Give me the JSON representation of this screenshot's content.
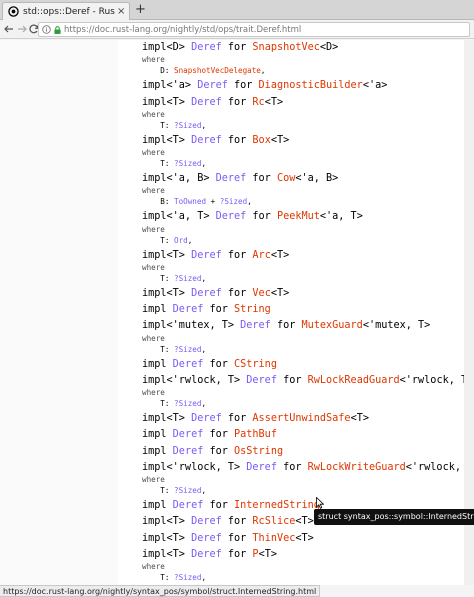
{
  "browser": {
    "tab_title": "std::ops::Deref - Rust",
    "close_glyph": "×",
    "newtab_glyph": "+",
    "url": "https://doc.rust-lang.org/nightly/std/ops/trait.Deref.html"
  },
  "code_lines": [
    {
      "kind": "impl",
      "tokens": [
        [
          "kw",
          "impl<D> "
        ],
        [
          "trait",
          "Deref"
        ],
        [
          "kw",
          " for "
        ],
        [
          "type",
          "SnapshotVec"
        ],
        [
          "kw",
          "<D>"
        ]
      ]
    },
    {
      "kind": "where",
      "text": "where"
    },
    {
      "kind": "bound",
      "tokens": [
        [
          "kw",
          "    D: "
        ],
        [
          "b-type",
          "SnapshotVecDelegate"
        ],
        [
          "kw",
          ","
        ]
      ]
    },
    {
      "kind": "impl",
      "tokens": [
        [
          "kw",
          "impl<'a> "
        ],
        [
          "trait",
          "Deref"
        ],
        [
          "kw",
          " for "
        ],
        [
          "type",
          "DiagnosticBuilder"
        ],
        [
          "kw",
          "<'a>"
        ]
      ]
    },
    {
      "kind": "impl",
      "tokens": [
        [
          "kw",
          "impl<T> "
        ],
        [
          "trait",
          "Deref"
        ],
        [
          "kw",
          " for "
        ],
        [
          "type",
          "Rc"
        ],
        [
          "kw",
          "<T>"
        ]
      ]
    },
    {
      "kind": "where",
      "text": "where"
    },
    {
      "kind": "bound",
      "tokens": [
        [
          "kw",
          "    T: "
        ],
        [
          "b-trait",
          "?Sized"
        ],
        [
          "kw",
          ","
        ]
      ]
    },
    {
      "kind": "impl",
      "tokens": [
        [
          "kw",
          "impl<T> "
        ],
        [
          "trait",
          "Deref"
        ],
        [
          "kw",
          " for "
        ],
        [
          "type",
          "Box"
        ],
        [
          "kw",
          "<T>"
        ]
      ]
    },
    {
      "kind": "where",
      "text": "where"
    },
    {
      "kind": "bound",
      "tokens": [
        [
          "kw",
          "    T: "
        ],
        [
          "b-trait",
          "?Sized"
        ],
        [
          "kw",
          ","
        ]
      ]
    },
    {
      "kind": "impl",
      "tokens": [
        [
          "kw",
          "impl<'a, B> "
        ],
        [
          "trait",
          "Deref"
        ],
        [
          "kw",
          " for "
        ],
        [
          "type",
          "Cow"
        ],
        [
          "kw",
          "<'a, B>"
        ]
      ]
    },
    {
      "kind": "where",
      "text": "where"
    },
    {
      "kind": "bound",
      "tokens": [
        [
          "kw",
          "    B: "
        ],
        [
          "b-trait",
          "ToOwned"
        ],
        [
          "kw",
          " + "
        ],
        [
          "b-trait",
          "?Sized"
        ],
        [
          "kw",
          ","
        ]
      ]
    },
    {
      "kind": "impl",
      "tokens": [
        [
          "kw",
          "impl<'a, T> "
        ],
        [
          "trait",
          "Deref"
        ],
        [
          "kw",
          " for "
        ],
        [
          "type",
          "PeekMut"
        ],
        [
          "kw",
          "<'a, T>"
        ]
      ]
    },
    {
      "kind": "where",
      "text": "where"
    },
    {
      "kind": "bound",
      "tokens": [
        [
          "kw",
          "    T: "
        ],
        [
          "b-trait",
          "Ord"
        ],
        [
          "kw",
          ","
        ]
      ]
    },
    {
      "kind": "impl",
      "tokens": [
        [
          "kw",
          "impl<T> "
        ],
        [
          "trait",
          "Deref"
        ],
        [
          "kw",
          " for "
        ],
        [
          "type",
          "Arc"
        ],
        [
          "kw",
          "<T>"
        ]
      ]
    },
    {
      "kind": "where",
      "text": "where"
    },
    {
      "kind": "bound",
      "tokens": [
        [
          "kw",
          "    T: "
        ],
        [
          "b-trait",
          "?Sized"
        ],
        [
          "kw",
          ","
        ]
      ]
    },
    {
      "kind": "impl",
      "tokens": [
        [
          "kw",
          "impl<T> "
        ],
        [
          "trait",
          "Deref"
        ],
        [
          "kw",
          " for "
        ],
        [
          "type",
          "Vec"
        ],
        [
          "kw",
          "<T>"
        ]
      ]
    },
    {
      "kind": "impl",
      "tokens": [
        [
          "kw",
          "impl "
        ],
        [
          "trait",
          "Deref"
        ],
        [
          "kw",
          " for "
        ],
        [
          "type",
          "String"
        ]
      ]
    },
    {
      "kind": "impl",
      "tokens": [
        [
          "kw",
          "impl<'mutex, T> "
        ],
        [
          "trait",
          "Deref"
        ],
        [
          "kw",
          " for "
        ],
        [
          "type",
          "MutexGuard"
        ],
        [
          "kw",
          "<'mutex, T>"
        ]
      ]
    },
    {
      "kind": "where",
      "text": "where"
    },
    {
      "kind": "bound",
      "tokens": [
        [
          "kw",
          "    T: "
        ],
        [
          "b-trait",
          "?Sized"
        ],
        [
          "kw",
          ","
        ]
      ]
    },
    {
      "kind": "impl",
      "tokens": [
        [
          "kw",
          "impl "
        ],
        [
          "trait",
          "Deref"
        ],
        [
          "kw",
          " for "
        ],
        [
          "type",
          "CString"
        ]
      ]
    },
    {
      "kind": "impl",
      "tokens": [
        [
          "kw",
          "impl<'rwlock, T> "
        ],
        [
          "trait",
          "Deref"
        ],
        [
          "kw",
          " for "
        ],
        [
          "type",
          "RwLockReadGuard"
        ],
        [
          "kw",
          "<'rwlock, T>"
        ]
      ]
    },
    {
      "kind": "where",
      "text": "where"
    },
    {
      "kind": "bound",
      "tokens": [
        [
          "kw",
          "    T: "
        ],
        [
          "b-trait",
          "?Sized"
        ],
        [
          "kw",
          ","
        ]
      ]
    },
    {
      "kind": "impl",
      "tokens": [
        [
          "kw",
          "impl<T> "
        ],
        [
          "trait",
          "Deref"
        ],
        [
          "kw",
          " for "
        ],
        [
          "type",
          "AssertUnwindSafe"
        ],
        [
          "kw",
          "<T>"
        ]
      ]
    },
    {
      "kind": "impl",
      "tokens": [
        [
          "kw",
          "impl "
        ],
        [
          "trait",
          "Deref"
        ],
        [
          "kw",
          " for "
        ],
        [
          "type",
          "PathBuf"
        ]
      ]
    },
    {
      "kind": "impl",
      "tokens": [
        [
          "kw",
          "impl "
        ],
        [
          "trait",
          "Deref"
        ],
        [
          "kw",
          " for "
        ],
        [
          "type",
          "OsString"
        ]
      ]
    },
    {
      "kind": "impl",
      "tokens": [
        [
          "kw",
          "impl<'rwlock, T> "
        ],
        [
          "trait",
          "Deref"
        ],
        [
          "kw",
          " for "
        ],
        [
          "type",
          "RwLockWriteGuard"
        ],
        [
          "kw",
          "<'rwlock, T>"
        ]
      ]
    },
    {
      "kind": "where",
      "text": "where"
    },
    {
      "kind": "bound",
      "tokens": [
        [
          "kw",
          "    T: "
        ],
        [
          "b-trait",
          "?Sized"
        ],
        [
          "kw",
          ","
        ]
      ]
    },
    {
      "kind": "impl",
      "tokens": [
        [
          "kw",
          "impl "
        ],
        [
          "trait",
          "Deref"
        ],
        [
          "kw",
          " for "
        ],
        [
          "type",
          "InternedString"
        ]
      ]
    },
    {
      "kind": "impl",
      "tokens": [
        [
          "kw",
          "impl<T> "
        ],
        [
          "trait",
          "Deref"
        ],
        [
          "kw",
          " for "
        ],
        [
          "type",
          "RcSlice"
        ],
        [
          "kw",
          "<T>"
        ]
      ]
    },
    {
      "kind": "impl",
      "tokens": [
        [
          "kw",
          "impl<T> "
        ],
        [
          "trait",
          "Deref"
        ],
        [
          "kw",
          " for "
        ],
        [
          "type",
          "ThinVec"
        ],
        [
          "kw",
          "<T>"
        ]
      ]
    },
    {
      "kind": "impl",
      "tokens": [
        [
          "kw",
          "impl<T> "
        ],
        [
          "trait",
          "Deref"
        ],
        [
          "kw",
          " for "
        ],
        [
          "type",
          "P"
        ],
        [
          "kw",
          "<T>"
        ]
      ]
    },
    {
      "kind": "where",
      "text": "where"
    },
    {
      "kind": "bound",
      "tokens": [
        [
          "kw",
          "    T: "
        ],
        [
          "b-trait",
          "?Sized"
        ],
        [
          "kw",
          ","
        ]
      ]
    }
  ],
  "tooltip": "struct syntax_pos::symbol::InternedString",
  "status_url": "https://doc.rust-lang.org/nightly/syntax_pos/symbol/struct.InternedString.html",
  "colors": {
    "trait": "#7c5af3",
    "type": "#df3600",
    "text": "#000000",
    "where": "#4d4d4c"
  },
  "icons": [
    "rust-favicon-icon",
    "back-arrow-icon",
    "forward-arrow-icon",
    "reload-icon",
    "info-icon",
    "lock-icon",
    "mouse-cursor-icon"
  ]
}
